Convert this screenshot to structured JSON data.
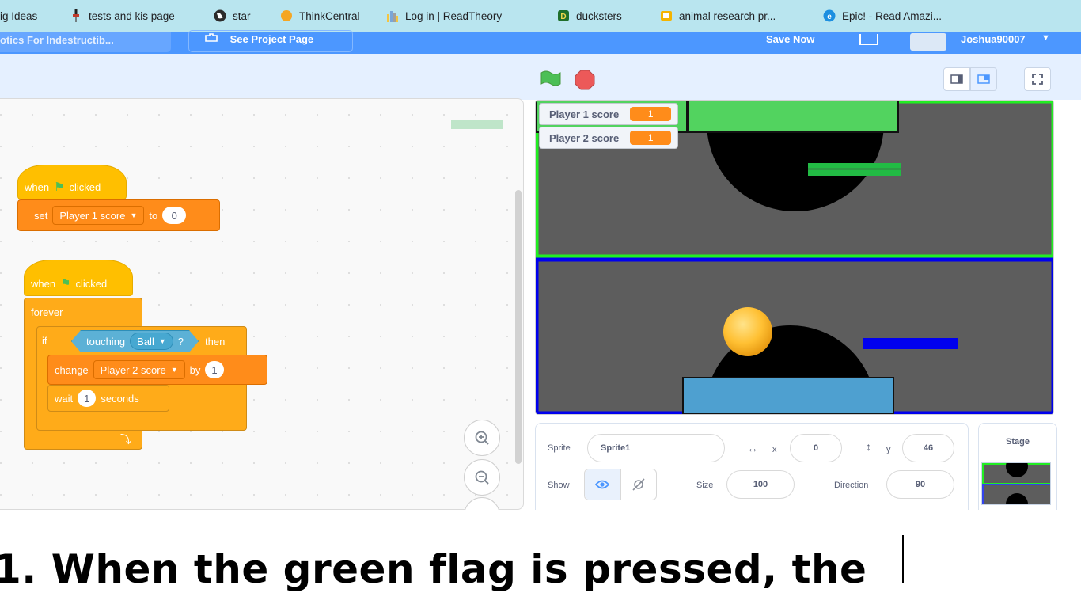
{
  "bookmarks": [
    {
      "label": "ig Ideas",
      "icon": ""
    },
    {
      "label": "tests and kis page",
      "icon": "pin-icon"
    },
    {
      "label": "star",
      "icon": "globe-icon"
    },
    {
      "label": "ThinkCentral",
      "icon": "orange-dot-icon"
    },
    {
      "label": "Log in | ReadTheory",
      "icon": "bars-icon"
    },
    {
      "label": "ducksters",
      "icon": "ducksters-icon"
    },
    {
      "label": "animal research pr...",
      "icon": "slides-icon"
    },
    {
      "label": "Epic! - Read Amazi...",
      "icon": "epic-icon"
    }
  ],
  "menubar": {
    "project_title": "otics For Indestructib...",
    "see_project": "See Project Page",
    "save_now": "Save Now",
    "username": "Joshua90007"
  },
  "code": {
    "script1": {
      "hat_when": "when",
      "hat_clicked": "clicked",
      "set_label": "set",
      "set_var": "Player 1 score",
      "set_to": "to",
      "set_value": "0"
    },
    "script2": {
      "hat_when": "when",
      "hat_clicked": "clicked",
      "forever": "forever",
      "if_label": "if",
      "touching": "touching",
      "touching_target": "Ball",
      "question": "?",
      "then": "then",
      "change_label": "change",
      "change_var": "Player 2 score",
      "by_label": "by",
      "change_value": "1",
      "wait_label": "wait",
      "wait_value": "1",
      "seconds": "seconds"
    }
  },
  "monitors": [
    {
      "label": "Player 1 score",
      "value": "1"
    },
    {
      "label": "Player 2 score",
      "value": "1"
    }
  ],
  "sprite_info": {
    "sprite_label": "Sprite",
    "sprite_name": "Sprite1",
    "x_label": "x",
    "x_value": "0",
    "y_label": "y",
    "y_value": "46",
    "show_label": "Show",
    "size_label": "Size",
    "size_value": "100",
    "direction_label": "Direction",
    "direction_value": "90"
  },
  "stage_panel": {
    "label": "Stage"
  },
  "caption": "1. When the green flag is pressed, the",
  "colors": {
    "scratch_blue": "#4c97ff",
    "event_yellow": "#ffbf00",
    "variable_orange": "#ff8c1a",
    "control_orange": "#ffab19",
    "sensing_blue": "#5cb1d6",
    "stage_gray": "#5d5d5d",
    "player1_green": "#52d35f",
    "player2_blue": "#0000ff",
    "ball_gold": "#ffc033",
    "paddle_light_blue": "#4ea0d0"
  }
}
